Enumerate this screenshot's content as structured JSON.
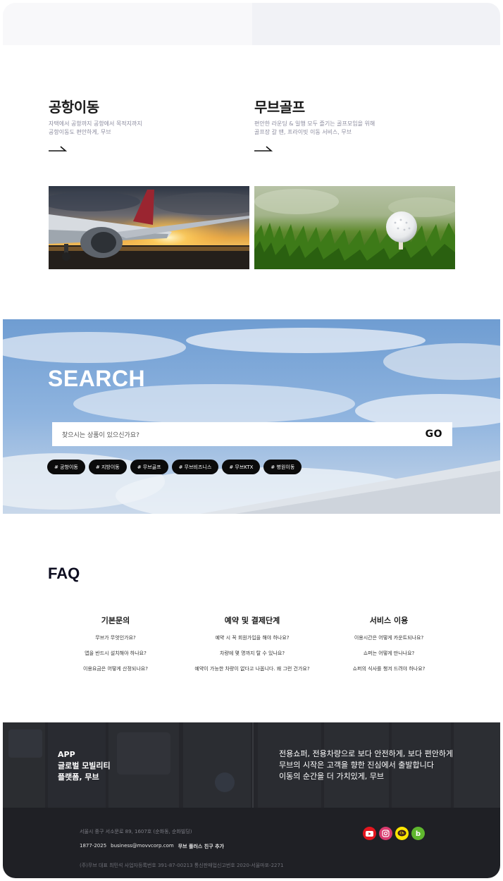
{
  "services": [
    {
      "title": "공항이동",
      "desc_line1": "자택에서 공항까지 공항에서 목적지까지",
      "desc_line2": "공항이동도 편안하게, 무브",
      "image": "airplane-sunset-photo"
    },
    {
      "title": "무브골프",
      "desc_line1": "편안한 라운딩 & 일행 모두 즐기는 골프모임을 위해",
      "desc_line2": "골프장 갈 땐, 프라이빗 이동 서비스, 무브",
      "image": "golf-ball-photo"
    }
  ],
  "search": {
    "title": "SEARCH",
    "placeholder": "찾으시는 상품이 있으신가요?",
    "go_label": "GO",
    "tags": [
      "# 공항이동",
      "# 지방이동",
      "# 무브골프",
      "# 무브비즈니스",
      "# 무브KTX",
      "# 병원이동"
    ]
  },
  "faq": {
    "title": "FAQ",
    "columns": [
      {
        "heading": "기본문의",
        "items": [
          "무브가 무엇인가요?",
          "앱을 반드시 설치해야 하나요?",
          "이용요금은 어떻게 산정되나요?"
        ]
      },
      {
        "heading": "예약 및 결제단계",
        "items": [
          "예약 시 꼭 회원가입을 해야 하나요?",
          "차량에 몇 명까지 탈 수 있나요?",
          "예약이 가능한 차량이 없다고 나옵니다. 왜 그런 건가요?"
        ]
      },
      {
        "heading": "서비스 이용",
        "items": [
          "이용시간은 어떻게 카운트되나요?",
          "쇼퍼는 어떻게 만나나요?",
          "쇼퍼의 식사를 챙겨 드려야 하나요?"
        ]
      }
    ]
  },
  "app_banner": {
    "left_line1": "APP",
    "left_line2": "글로벌 모빌리티",
    "left_line3": "플랫폼, 무브",
    "right_line1": "전용쇼퍼, 전용차량으로 보다 안전하게, 보다 편안하게",
    "right_line2": "무브의 시작은 고객을 향한 진심에서 출발합니다",
    "right_line3": "이동의 순간을 더 가치있게, 무브"
  },
  "footer": {
    "address": "서울시 중구 서소문로 89, 1607호 (순화동, 순화빌딩)",
    "phone": "1877-2025",
    "email": "business@movvcorp.com",
    "kakao": "무브 플러스 친구 추가",
    "corp_info": "(주)무브 대표 최민석 사업자등록번호 391-87-00213 통신판매업신고번호 2020-서울마포-2271",
    "social_icons": [
      "youtube-icon",
      "instagram-icon",
      "kakao-channel-icon",
      "blog-icon"
    ],
    "social_colors": [
      "#e3161f",
      "#d83a6e",
      "#ffe600",
      "#5fb72e"
    ]
  }
}
